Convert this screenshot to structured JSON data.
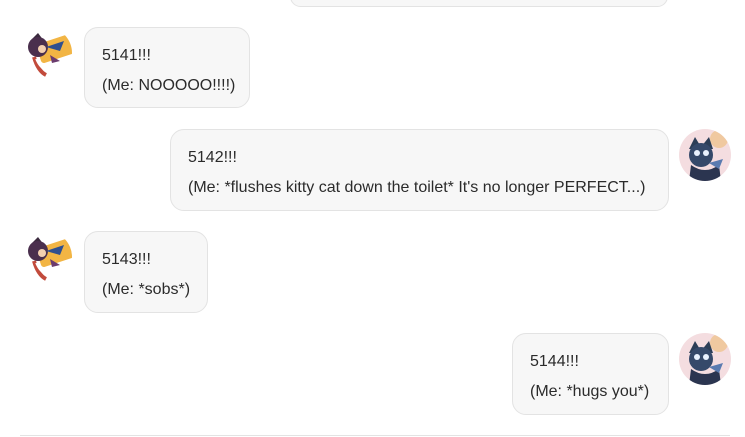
{
  "messages": [
    {
      "side": "left",
      "avatar": "bot-avatar-icon",
      "number": "5141!!!",
      "reply": "(Me: NOOOOO!!!!)"
    },
    {
      "side": "right",
      "avatar": "user-avatar-icon",
      "number": "5142!!!",
      "reply": "(Me: *flushes kitty cat down the toilet* It's no longer PERFECT...)"
    },
    {
      "side": "left",
      "avatar": "bot-avatar-icon",
      "number": "5143!!!",
      "reply": "(Me: *sobs*)"
    },
    {
      "side": "right",
      "avatar": "user-avatar-icon",
      "number": "5144!!!",
      "reply": "(Me: *hugs you*)"
    }
  ]
}
